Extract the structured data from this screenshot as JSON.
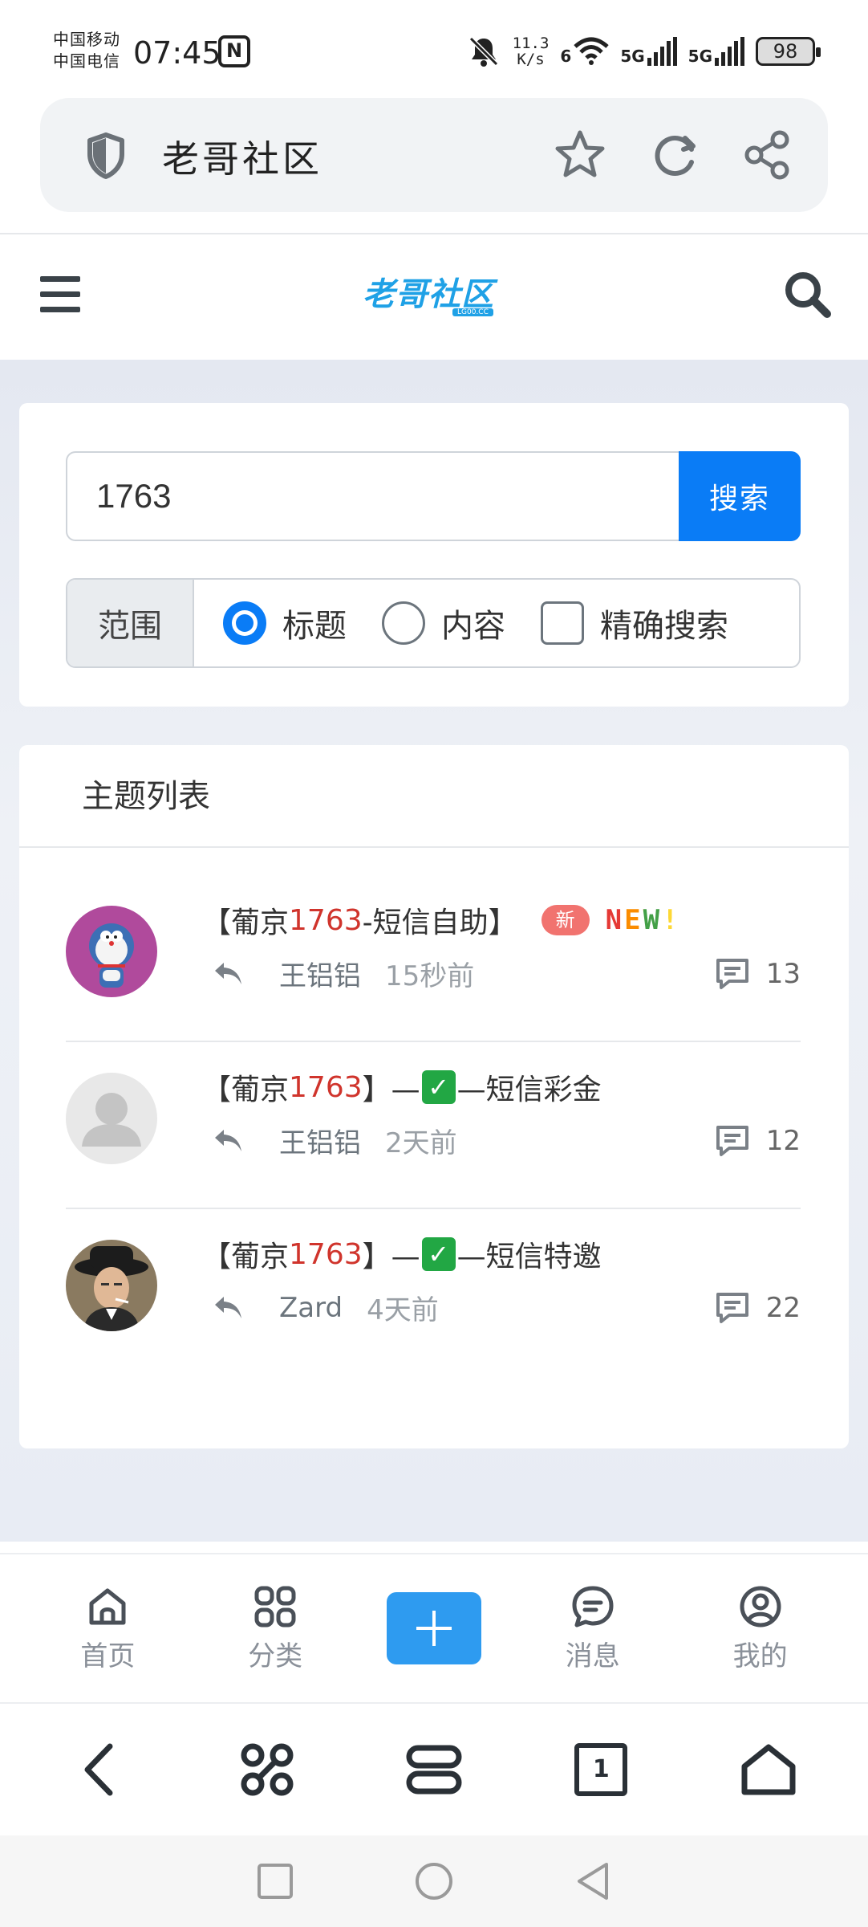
{
  "status_bar": {
    "carrier_1": "中国移动",
    "carrier_2": "中国电信",
    "time": "07:45",
    "nfc_label": "N",
    "speed_value": "11.3",
    "speed_unit": "K/s",
    "wifi_label": "6",
    "sim1_label": "5G",
    "sim2_label": "5G",
    "battery": "98"
  },
  "browser": {
    "title": "老哥社区"
  },
  "site": {
    "logo_text": "老哥社区",
    "logo_sub": "LG00.CC"
  },
  "search": {
    "query": "1763",
    "button_label": "搜索",
    "scope_label": "范围",
    "options": [
      "标题",
      "内容",
      "精确搜索"
    ],
    "selected_option": "标题"
  },
  "thread_list": {
    "heading": "主题列表",
    "highlight": "1763",
    "threads": [
      {
        "prefix": "【葡京",
        "highlight": "1763",
        "suffix": "-短信自助】",
        "badge": "新",
        "new_tag": "NEW!",
        "author": "王铝铝",
        "time": "15秒前",
        "replies": "13"
      },
      {
        "prefix": "【葡京",
        "highlight": "1763",
        "mid": "】—",
        "check": "✓",
        "suffix": "—短信彩金",
        "author": "王铝铝",
        "time": "2天前",
        "replies": "12"
      },
      {
        "prefix": "【葡京",
        "highlight": "1763",
        "mid": "】—",
        "check": "✓",
        "suffix": "—短信特邀",
        "author": "Zard",
        "time": "4天前",
        "replies": "22"
      }
    ]
  },
  "bottom_nav": {
    "items": [
      {
        "label": "首页",
        "icon": "home-icon"
      },
      {
        "label": "分类",
        "icon": "grid-icon"
      },
      {
        "label": "",
        "icon": "plus-icon"
      },
      {
        "label": "消息",
        "icon": "message-icon"
      },
      {
        "label": "我的",
        "icon": "user-icon"
      }
    ]
  },
  "browser_toolbar": {
    "tab_count": "1"
  },
  "colors": {
    "primary": "#0a7cf6",
    "highlight": "#d0342c",
    "badge": "#f1736f",
    "plus_button": "#2e9bf0"
  }
}
